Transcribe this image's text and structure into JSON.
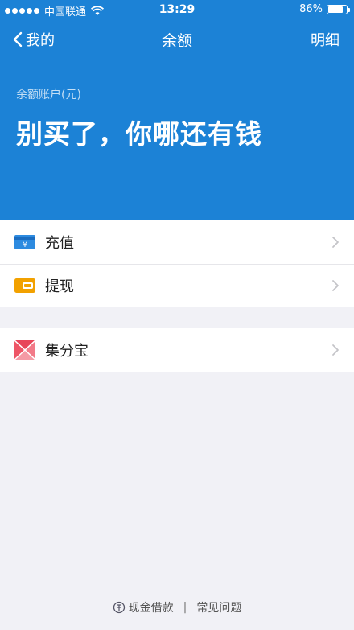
{
  "status_bar": {
    "carrier": "中国联通",
    "time": "13:29",
    "battery_percent_text": "86%",
    "battery_level": 0.86
  },
  "nav": {
    "back_label": "我的",
    "title": "余额",
    "right_label": "明细"
  },
  "account": {
    "label": "余额账户(元)",
    "balance_text": "别买了，你哪还有钱"
  },
  "section1": [
    {
      "label": "充值",
      "icon": "recharge-card-icon",
      "color": "#2d8be0"
    },
    {
      "label": "提现",
      "icon": "wallet-icon",
      "color": "#f2a100"
    }
  ],
  "section2": [
    {
      "label": "集分宝",
      "icon": "jifenbao-icon",
      "color": "#ee5566"
    }
  ],
  "footer": {
    "loan_label": "现金借款",
    "separator": "|",
    "faq_label": "常见问题"
  },
  "colors": {
    "header_bg": "#1c82d6",
    "page_bg": "#f1f1f6"
  }
}
